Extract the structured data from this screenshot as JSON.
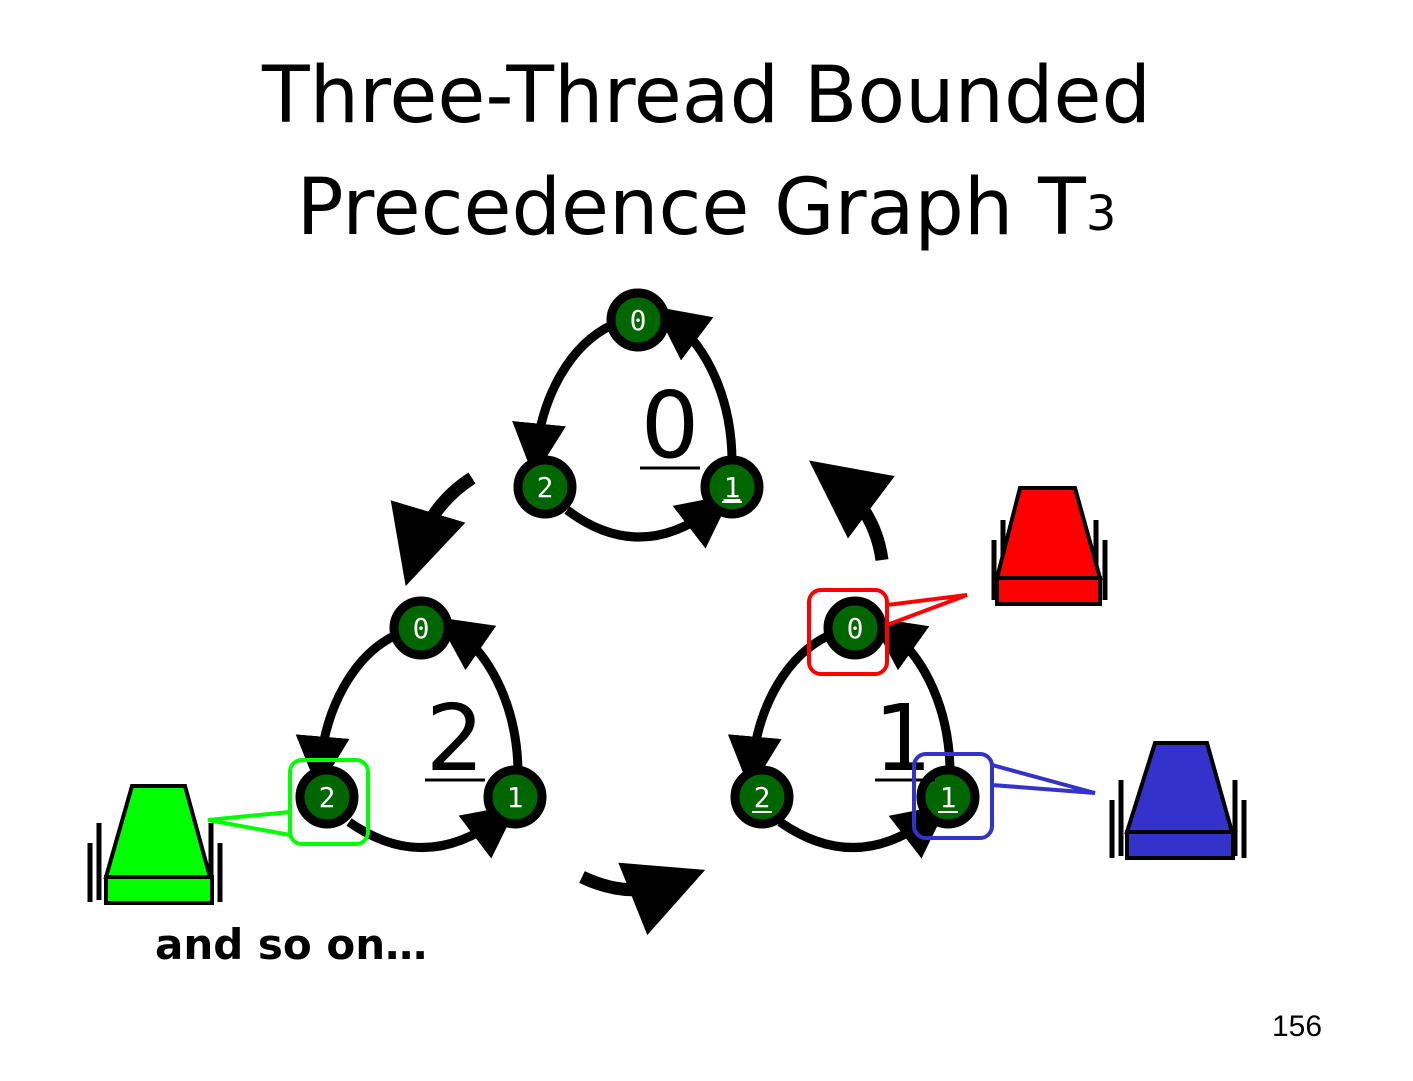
{
  "slide": {
    "title_line1": "Three-Thread Bounded",
    "title_line2": "Precedence Graph T",
    "title_sup": "3",
    "caption": "and so on…",
    "page_number": "156"
  },
  "subgraphs": [
    {
      "label": "0",
      "nodes": [
        "0",
        "1",
        "2"
      ]
    },
    {
      "label": "2",
      "nodes": [
        "0",
        "1",
        "2"
      ]
    },
    {
      "label": "1",
      "nodes": [
        "0",
        "1",
        "2"
      ]
    }
  ],
  "threads": [
    {
      "color": "#ff0000",
      "points_to": "subgraph 1, node 0"
    },
    {
      "color": "#3333cc",
      "points_to": "subgraph 1, node 1"
    },
    {
      "color": "#00ff00",
      "points_to": "subgraph 2, node 2"
    }
  ],
  "colors": {
    "node_fill": "#006600",
    "node_stroke": "#000000"
  }
}
